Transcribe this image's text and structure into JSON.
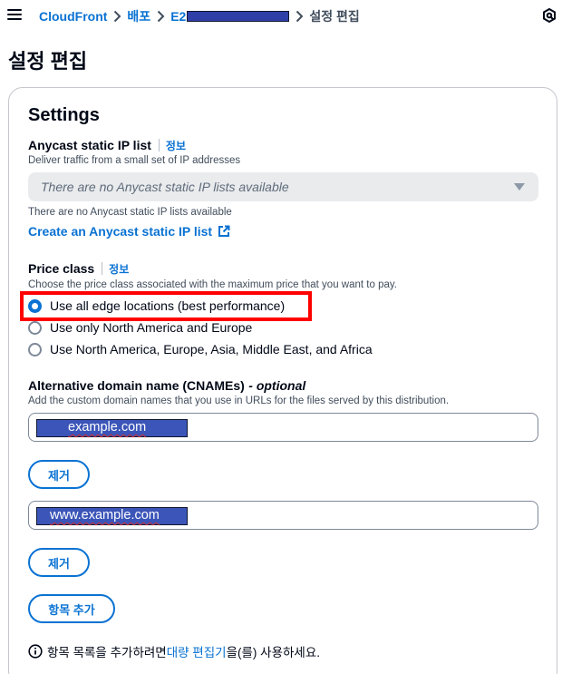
{
  "breadcrumb": {
    "items": [
      "CloudFront",
      "배포",
      "E2",
      "설정 편집"
    ],
    "separator": "chevron-right-icon"
  },
  "page": {
    "title": "설정 편집"
  },
  "settings": {
    "title": "Settings",
    "anycast": {
      "label": "Anycast static IP list",
      "info": "정보",
      "description": "Deliver traffic from a small set of IP addresses",
      "placeholder": "There are no Anycast static IP lists available",
      "note": "There are no Anycast static IP lists available",
      "create_link": "Create an Anycast static IP list"
    },
    "price_class": {
      "label": "Price class",
      "info": "정보",
      "description": "Choose the price class associated with the maximum price that you want to pay.",
      "options": [
        "Use all edge locations (best performance)",
        "Use only North America and Europe",
        "Use North America, Europe, Asia, Middle East, and Africa"
      ],
      "selected_index": 0
    },
    "cname": {
      "label": "Alternative domain name (CNAMEs)",
      "optional": "- optional",
      "description": "Add the custom domain names that you use in URLs for the files served by this distribution.",
      "entries": [
        "example.com",
        "www.example.com"
      ],
      "remove_label": "제거",
      "add_label": "항목 추가"
    },
    "footnote": {
      "prefix": "항목 목록을 추가하려면 ",
      "link": "대량 편집기",
      "suffix": "을(를) 사용하세요."
    }
  },
  "colors": {
    "link": "#0972d3",
    "highlight": "#ff0000",
    "redaction": "#3b55b8"
  }
}
